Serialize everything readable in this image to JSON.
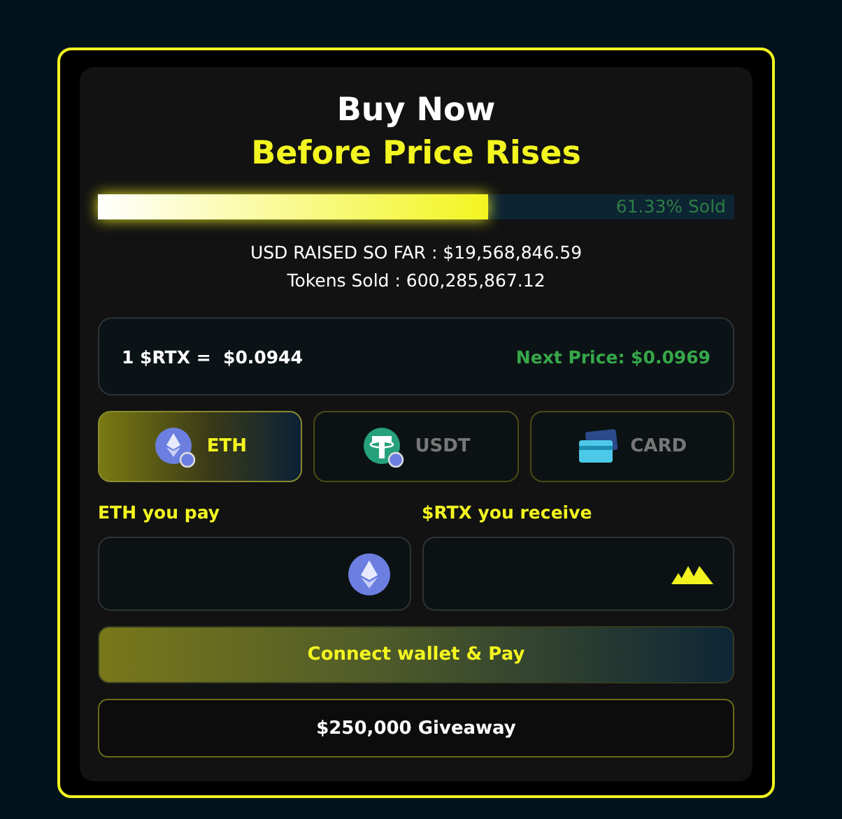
{
  "heading": {
    "title": "Buy Now",
    "subtitle": "Before Price Rises"
  },
  "progress": {
    "level": 0.6133,
    "label": "61.33% Sold"
  },
  "stats": [
    "USD RAISED SO FAR : $19,568,846.59",
    "Tokens Sold : 600,285,867.12"
  ],
  "price": {
    "current": "1 $RTX =  $0.0944",
    "next": "Next Price: $0.0969"
  },
  "payment_tabs": [
    {
      "label": "ETH",
      "kind": "eth",
      "selected": true
    },
    {
      "label": "USDT",
      "kind": "usdt",
      "selected": false
    },
    {
      "label": "CARD",
      "kind": "card",
      "selected": false
    }
  ],
  "fields": [
    {
      "label": "ETH you pay",
      "kind": "eth"
    },
    {
      "label": "$RTX you receive",
      "kind": "rtx"
    }
  ],
  "pay_button": "Connect wallet & Pay",
  "giveaway": "$250,000 Giveaway"
}
